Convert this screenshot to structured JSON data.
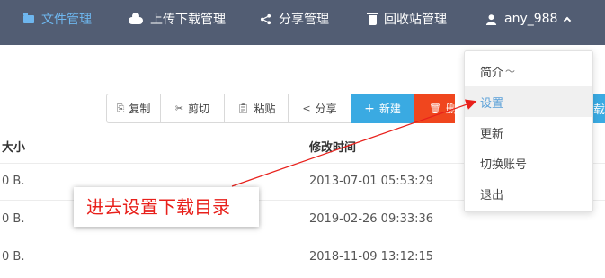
{
  "topnav": {
    "items": [
      {
        "label": "文件管理",
        "icon": "folder-icon",
        "active": true
      },
      {
        "label": "上传下载管理",
        "icon": "cloud-icon"
      },
      {
        "label": "分享管理",
        "icon": "share-icon"
      },
      {
        "label": "回收站管理",
        "icon": "trash-icon"
      }
    ],
    "user": {
      "label": "any_988",
      "icon": "user-icon"
    }
  },
  "toolbar": {
    "buttons": [
      {
        "label": "复制",
        "icon": "copy-icon"
      },
      {
        "label": "剪切",
        "icon": "scissors-icon"
      },
      {
        "label": "粘贴",
        "icon": "clipboard-icon"
      },
      {
        "label": "分享",
        "icon": "share-icon"
      },
      {
        "label": "新建",
        "icon": "plus-icon"
      },
      {
        "label": "删",
        "icon": "trash-icon"
      }
    ],
    "partial_right_label": "载"
  },
  "table": {
    "headers": {
      "size": "大小",
      "modified": "修改时间"
    },
    "rows": [
      {
        "size": "0 B.",
        "modified": "2013-07-01 05:53:29"
      },
      {
        "size": "0 B.",
        "modified": "2019-02-26 09:33:36"
      },
      {
        "size": "0 B.",
        "modified": "2018-11-09 13:12:15"
      }
    ]
  },
  "user_menu": {
    "items": [
      {
        "label": "简介",
        "suffix": "〜"
      },
      {
        "label": "设置",
        "highlighted": true
      },
      {
        "label": "更新"
      },
      {
        "label": "切换账号"
      },
      {
        "label": "退出"
      }
    ]
  },
  "annotation": {
    "text": "进去设置下载目录",
    "color": "#e8201b"
  },
  "colors": {
    "nav_bg": "#525d73",
    "nav_active": "#6eb6ee",
    "primary": "#3aaae2",
    "danger": "#f0461e"
  }
}
